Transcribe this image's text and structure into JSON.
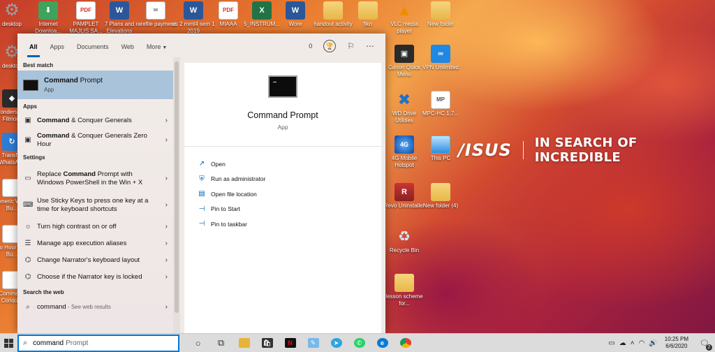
{
  "desktop_icons": [
    {
      "label": "desktop",
      "glyph": "⚙",
      "kind": "g-gear"
    },
    {
      "label": "Internet Downloa...",
      "glyph": "⬇",
      "kind": "g-green"
    },
    {
      "label": "PAMPLET MAJLIS SA...",
      "glyph": "PDF",
      "kind": "g-pdf"
    },
    {
      "label": "7 Plans and Elevations",
      "glyph": "W",
      "kind": "g-word"
    },
    {
      "label": "rarefile payment",
      "glyph": "✉",
      "kind": "g-file"
    },
    {
      "label": "us 2 mmt4 sem 1 2019",
      "glyph": "W",
      "kind": "g-word"
    },
    {
      "label": "MIAAA",
      "glyph": "PDF",
      "kind": "g-pdf"
    },
    {
      "label": "5_INSTRUM...",
      "glyph": "X",
      "kind": "g-excel"
    },
    {
      "label": "Wore",
      "glyph": "W",
      "kind": "g-word"
    },
    {
      "label": "handout activity",
      "glyph": "",
      "kind": "g-folder"
    },
    {
      "label": "fikri",
      "glyph": "",
      "kind": "g-folder"
    },
    {
      "label": "VLC media player",
      "glyph": "▲",
      "kind": "g-vlc"
    },
    {
      "label": "New folder",
      "glyph": "",
      "kind": "g-folder"
    },
    {
      "label": "desktop",
      "glyph": "⚙",
      "kind": "g-gear"
    },
    {
      "label": "Canon Quick Menu",
      "glyph": "▣",
      "kind": "g-dark"
    },
    {
      "label": "VPN Unlimited",
      "glyph": "∞",
      "kind": "g-vpn"
    },
    {
      "label": "Wondershare Filmora",
      "glyph": "◆",
      "kind": "g-dark"
    },
    {
      "label": "WD Drive Utilities",
      "glyph": "✖",
      "kind": "g-tools"
    },
    {
      "label": "MPC-HC 1.7...",
      "glyph": "MP",
      "kind": "g-file"
    },
    {
      "label": "Transfer WhatsApp",
      "glyph": "↻",
      "kind": "g-blue"
    },
    {
      "label": "4G Mobile Hotspot",
      "glyph": "4G",
      "kind": "g-4g"
    },
    {
      "label": "This PC",
      "glyph": "",
      "kind": "g-pc"
    },
    {
      "label": "Generic World Bu...",
      "glyph": "",
      "kind": "g-doc"
    },
    {
      "label": "Revo Uninstaller",
      "glyph": "R",
      "kind": "g-revo"
    },
    {
      "label": "New folder (4)",
      "glyph": "",
      "kind": "g-folder"
    },
    {
      "label": "Zero Hour World Bu...",
      "glyph": "",
      "kind": "g-doc"
    },
    {
      "label": "Recycle Bin",
      "glyph": "♻",
      "kind": "g-bin"
    },
    {
      "label": "Command Conquer",
      "glyph": "",
      "kind": "g-doc"
    },
    {
      "label": "lesson scheme for...",
      "glyph": "",
      "kind": "g-folder"
    }
  ],
  "brand": {
    "logo": "/ISUS",
    "tagline": "IN SEARCH OF INCREDIBLE"
  },
  "search_panel": {
    "tabs": [
      {
        "label": "All",
        "active": true
      },
      {
        "label": "Apps"
      },
      {
        "label": "Documents"
      },
      {
        "label": "Web"
      },
      {
        "label": "More"
      }
    ],
    "rewards_count": "0",
    "sections": {
      "best_match": "Best match",
      "apps": "Apps",
      "settings": "Settings",
      "search_web": "Search the web"
    },
    "best_match": {
      "title_bold": "Command",
      "title_rest": " Prompt",
      "subtitle": "App"
    },
    "apps": [
      {
        "bold": "Command",
        "rest": " & Conquer Generals"
      },
      {
        "bold": "Command",
        "rest": " & Conquer Generals Zero Hour"
      }
    ],
    "settings": [
      {
        "pre": "Replace ",
        "bold": "Command",
        "rest": " Prompt with Windows PowerShell in the Win + X"
      },
      {
        "pre": "Use Sticky Keys to press one key at a time for keyboard shortcuts",
        "bold": "",
        "rest": ""
      },
      {
        "pre": "Turn high contrast on or off",
        "bold": "",
        "rest": ""
      },
      {
        "pre": "Manage app execution aliases",
        "bold": "",
        "rest": ""
      },
      {
        "pre": "Change Narrator's keyboard layout",
        "bold": "",
        "rest": ""
      },
      {
        "pre": "Choose if the Narrator key is locked",
        "bold": "",
        "rest": ""
      }
    ],
    "web_result": {
      "query": "command",
      "suffix": " - See web results"
    },
    "preview": {
      "title": "Command Prompt",
      "subtitle": "App",
      "actions": [
        "Open",
        "Run as administrator",
        "Open file location",
        "Pin to Start",
        "Pin to taskbar"
      ]
    }
  },
  "taskbar": {
    "search_typed": "command",
    "search_ghost": "Prompt",
    "time": "10:25 PM",
    "date": "6/6/2020",
    "notification_count": "2"
  }
}
